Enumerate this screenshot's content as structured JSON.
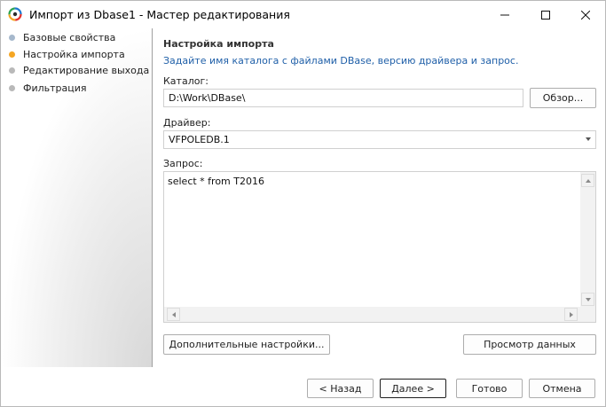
{
  "window": {
    "title": "Импорт из Dbase1 - Мастер редактирования",
    "controls": {
      "minimize": "—",
      "maximize": "☐",
      "close": "✕"
    }
  },
  "steps": [
    {
      "label": "Базовые свойства",
      "color": "#a6b8cc"
    },
    {
      "label": "Настройка импорта",
      "color": "#f5a623"
    },
    {
      "label": "Редактирование выхода",
      "color": "#b9b9b9"
    },
    {
      "label": "Фильтрация",
      "color": "#b9b9b9"
    }
  ],
  "section": {
    "title": "Настройка импорта",
    "description": "Задайте имя каталога с файлами DBase, версию драйвера и запрос."
  },
  "catalog": {
    "label": "Каталог:",
    "value": "D:\\Work\\DBase\\",
    "browse_label": "Обзор..."
  },
  "driver": {
    "label": "Драйвер:",
    "value": "VFPOLEDB.1"
  },
  "query": {
    "label": "Запрос:",
    "value": "select * from T2016"
  },
  "buttons": {
    "advanced": "Дополнительные настройки...",
    "preview": "Просмотр данных",
    "back": "< Назад",
    "next": "Далее >",
    "done": "Готово",
    "cancel": "Отмена"
  },
  "icons": {
    "app": "app-logo-icon",
    "scroll_up": "scroll-up-icon",
    "scroll_down": "scroll-down-icon",
    "scroll_left": "scroll-left-icon",
    "scroll_right": "scroll-right-icon",
    "combo_arrow": "chevron-down-icon"
  }
}
